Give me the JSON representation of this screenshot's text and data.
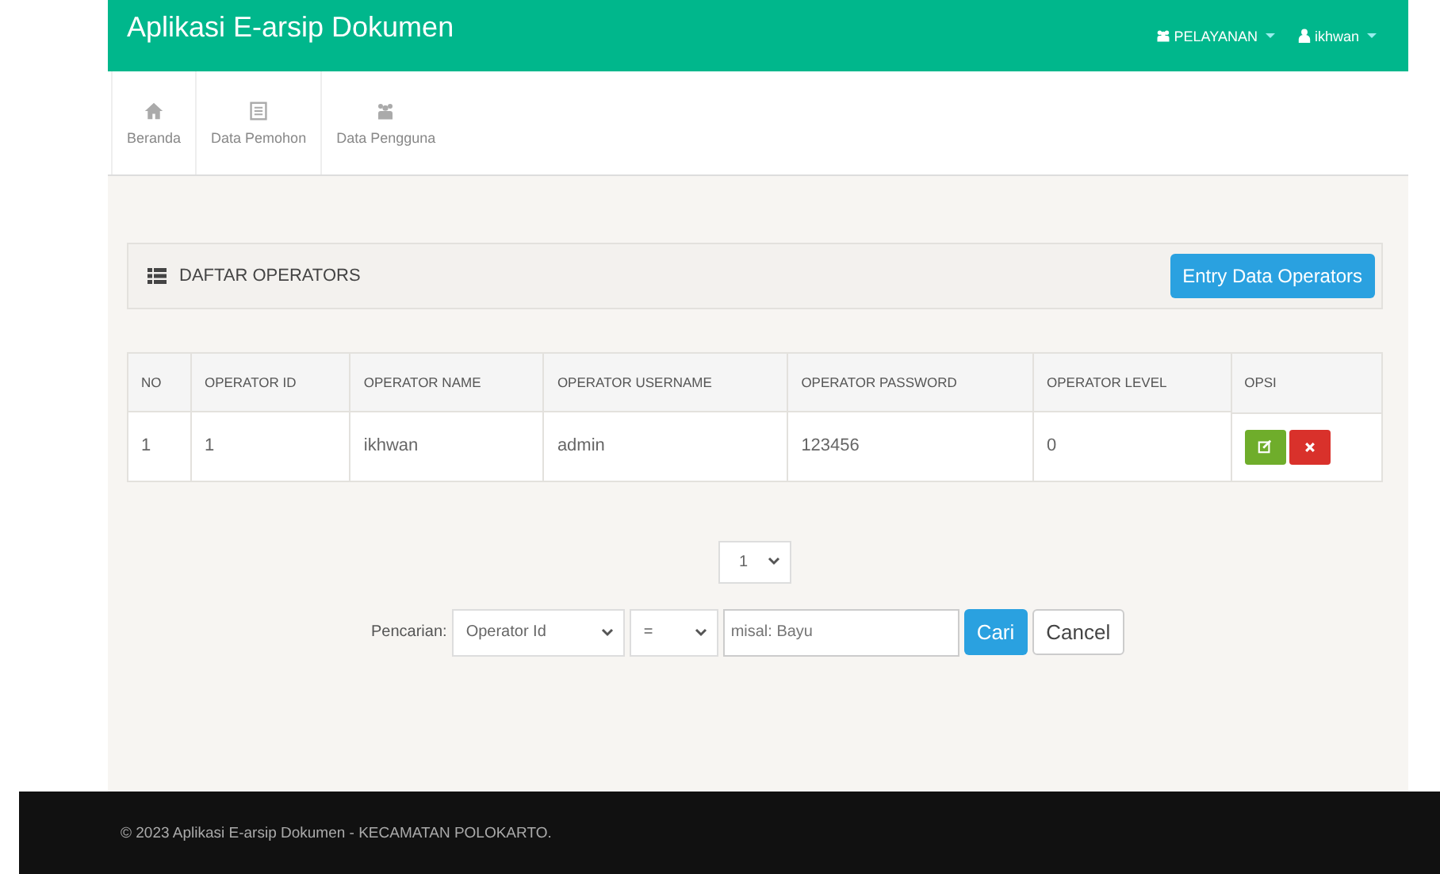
{
  "app_title": "Aplikasi E-arsip Dokumen",
  "top_menu": [
    {
      "kind": "group",
      "label": "PELAYANAN"
    },
    {
      "kind": "user",
      "label": "ikhwan"
    }
  ],
  "nav": [
    {
      "kind": "home",
      "label": "Beranda"
    },
    {
      "kind": "list",
      "label": "Data Pemohon"
    },
    {
      "kind": "users",
      "label": "Data Pengguna"
    }
  ],
  "panel": {
    "title": "DAFTAR OPERATORS",
    "button": "Entry Data Operators"
  },
  "table": {
    "columns": [
      "NO",
      "OPERATOR ID",
      "OPERATOR NAME",
      "OPERATOR USERNAME",
      "OPERATOR PASSWORD",
      "OPERATOR LEVEL",
      "OPSI"
    ],
    "rows": [
      {
        "cells": [
          "1",
          "1",
          "ikhwan",
          "admin",
          "123456",
          "0"
        ]
      }
    ]
  },
  "pager": {
    "value": "1"
  },
  "search": {
    "label": "Pencarian:",
    "field": "Operator Id",
    "operator": "=",
    "placeholder": "misal: Bayu",
    "submit": "Cari",
    "cancel": "Cancel"
  },
  "footer": "© 2023 Aplikasi E-arsip Dokumen - KECAMATAN POLOKARTO."
}
